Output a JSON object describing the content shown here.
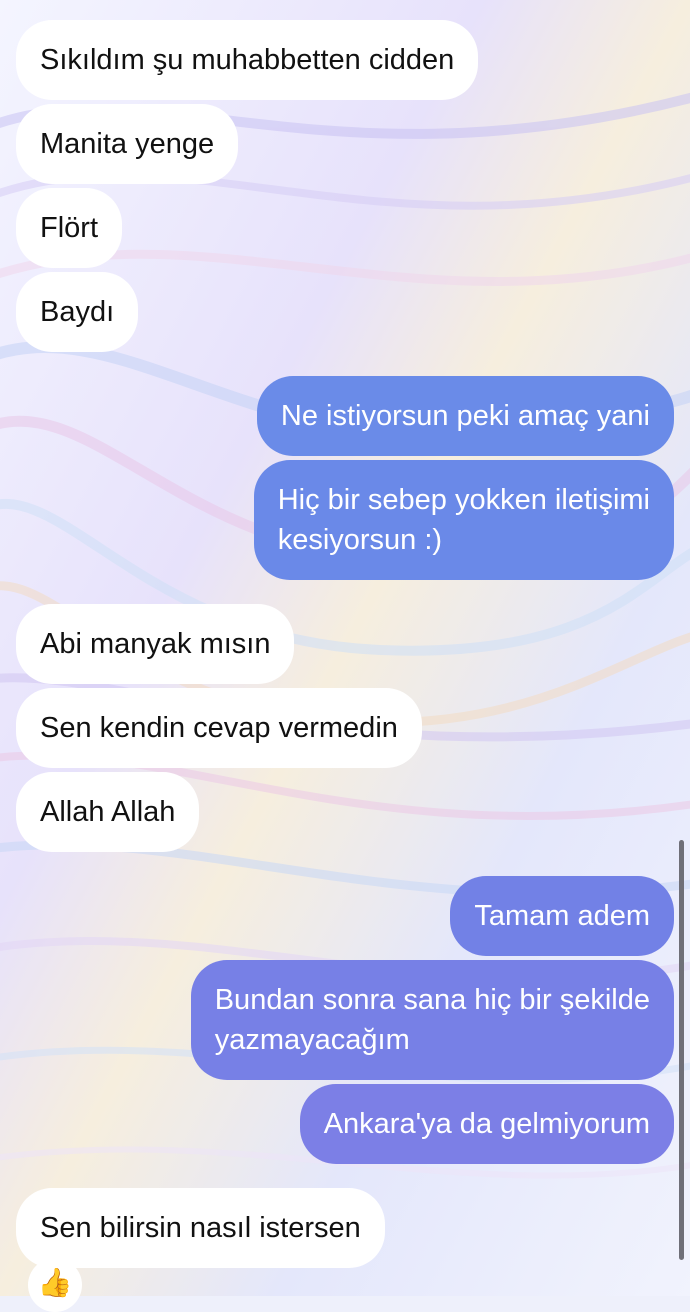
{
  "chat": {
    "messages": [
      {
        "dir": "in",
        "text": "Sıkıldım şu muhabbetten  cidden"
      },
      {
        "dir": "in",
        "text": "Manita yenge"
      },
      {
        "dir": "in",
        "text": "Flört"
      },
      {
        "dir": "in",
        "text": "Baydı"
      },
      {
        "dir": "out",
        "text": "Ne istiyorsun peki amaç yani"
      },
      {
        "dir": "out",
        "text": "Hiç bir sebep yokken iletişimi\nkesiyorsun :)"
      },
      {
        "dir": "in",
        "text": "Abi manyak mısın"
      },
      {
        "dir": "in",
        "text": "Sen kendin cevap vermedin"
      },
      {
        "dir": "in",
        "text": "Allah Allah"
      },
      {
        "dir": "out",
        "text": "Tamam adem"
      },
      {
        "dir": "out",
        "text": "Bundan sonra sana hiç bir şekilde\nyazmayacağım"
      },
      {
        "dir": "out",
        "text": "Ankara'ya da gelmiyorum"
      },
      {
        "dir": "in",
        "text": "Sen bilirsin nasıl istersen"
      }
    ],
    "reaction": "👍"
  },
  "colors": {
    "incoming_bubble": "#ffffff",
    "outgoing_top": "#6a8be8",
    "outgoing_bottom": "#7c7fe6"
  }
}
